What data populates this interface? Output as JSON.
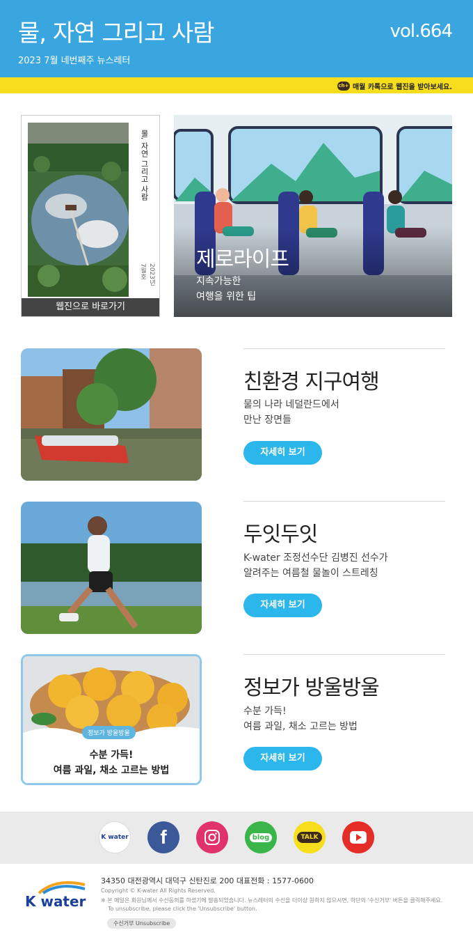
{
  "header": {
    "title": "물, 자연 그리고 사람",
    "subtitle": "2023 7월 네번째주 뉴스레터",
    "volume": "vol.664",
    "kakao_message": "매월 카톡으로 웹진을 받아보세요.",
    "kakao_badge": "ch+"
  },
  "cover": {
    "spine_title": "물, 자연 그리고 사람",
    "spine_date": "2023년 7월호",
    "button_label": "웹진으로 바로가기"
  },
  "hero": {
    "title": "제로라이프",
    "subtitle_line1": "지속가능한",
    "subtitle_line2": "여행을 위한 팁"
  },
  "articles": [
    {
      "title": "친환경 지구여행",
      "desc_line1": "물의 나라 네덜란드에서",
      "desc_line2": "만난 장면들",
      "button": "자세히 보기"
    },
    {
      "title": "두잇두잇",
      "desc_line1": "K-water 조정선수단 김병진 선수가",
      "desc_line2": "알려주는 여름철 물놀이 스트레칭",
      "button": "자세히 보기"
    },
    {
      "title": "정보가 방울방울",
      "desc_line1": "수분 가득!",
      "desc_line2": "여름 과일, 채소 고르는 방법",
      "button": "자세히 보기",
      "thumb_badge": "정보가 방울방울",
      "thumb_line1": "수분 가득!",
      "thumb_line2": "여름 과일, 채소 고르는 방법"
    }
  ],
  "social": {
    "kwater_label": "K water",
    "blog_label": "blog",
    "talk_label": "TALK"
  },
  "footer": {
    "logo_text": "K water",
    "address": "34350 대전광역시 대덕구 신탄진로 200  대표전화 : 1577-0600",
    "copyright": "Copyright © K-water All Rights Reserved.",
    "notice": "※ 본 메일은 회원님께서 수신동의를 하셨기에 발송되었습니다. 뉴스레터의 수신을 더이상 원하지 않으시면, 하단의 '수신거부' 버튼을 클릭해주세요.",
    "notice_en": "To unsubscribe, please click the 'Unsubscribe' button.",
    "unsubscribe": "수신거부  Unsubscribe"
  },
  "colors": {
    "header_blue": "#3aa6e0",
    "kakao_yellow": "#f6de1d",
    "button_blue": "#2bb6ec"
  }
}
